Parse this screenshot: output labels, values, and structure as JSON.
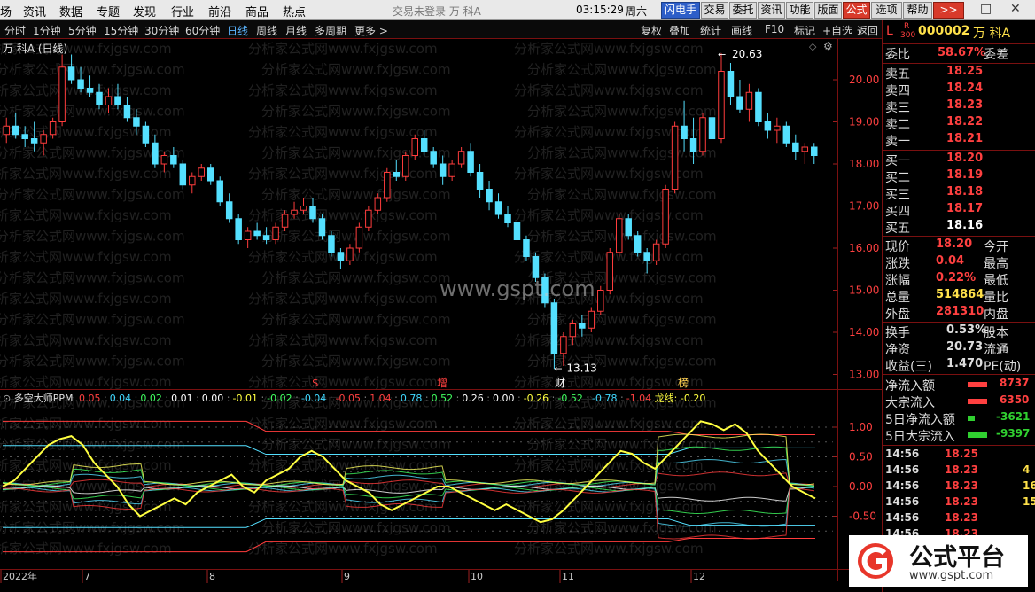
{
  "menu": {
    "items": [
      "场",
      "资讯",
      "数据",
      "专题",
      "发现",
      "行业",
      "前沿",
      "商品",
      "热点"
    ],
    "center_text": "交易未登录   万 科A",
    "time": "03:15:29",
    "weekday": "周六",
    "buttons": [
      "闪电手",
      "交易",
      "委托",
      "资讯",
      "功能",
      "版面",
      "公式",
      "选项",
      "帮助",
      ">>"
    ],
    "window_controls": [
      "□",
      "✕"
    ]
  },
  "toolbar": {
    "periods": [
      "分时",
      "1分钟",
      "5分钟",
      "15分钟",
      "30分钟",
      "60分钟",
      "日线",
      "周线",
      "月线",
      "多周期",
      "更多 >"
    ],
    "active_period": "日线",
    "right_buttons": [
      "复权",
      "叠加",
      "统计",
      "画线",
      "F10",
      "标记",
      "+自选",
      "返回"
    ]
  },
  "chart_title": "万 科A (日线)",
  "watermarks": {
    "faint": "分析家公式网www.fxjgsw.com",
    "center": "www.gspt.com"
  },
  "price_axis": [
    "20.00",
    "19.00",
    "18.00",
    "17.00",
    "16.00",
    "15.00",
    "14.00",
    "13.00"
  ],
  "max_label": "20.63",
  "min_label": "13.13",
  "event_markers": [
    {
      "label": "$",
      "color": "#ff4040"
    },
    {
      "label": "增",
      "color": "#ff4040"
    },
    {
      "label": "财",
      "color": "#ffffff"
    },
    {
      "label": "榜",
      "color": "#ffd050"
    }
  ],
  "indicator": {
    "name": "多空大师PPM",
    "values": [
      {
        "v": "0.05",
        "c": "#ff4040"
      },
      {
        "v": "0.04",
        "c": "#40d8ff"
      },
      {
        "v": "0.02",
        "c": "#40ff60"
      },
      {
        "v": "0.01",
        "c": "#ffffff"
      },
      {
        "v": "0.00",
        "c": "#ffffff"
      },
      {
        "v": "-0.01",
        "c": "#ffff40"
      },
      {
        "v": "-0.02",
        "c": "#40ff60"
      },
      {
        "v": "-0.04",
        "c": "#40d8ff"
      },
      {
        "v": "-0.05",
        "c": "#ff4040"
      },
      {
        "v": "1.04",
        "c": "#ff4040"
      },
      {
        "v": "0.78",
        "c": "#40d8ff"
      },
      {
        "v": "0.52",
        "c": "#40ff60"
      },
      {
        "v": "0.26",
        "c": "#ffffff"
      },
      {
        "v": "0.00",
        "c": "#ffffff"
      },
      {
        "v": "-0.26",
        "c": "#ffff40"
      },
      {
        "v": "-0.52",
        "c": "#40ff60"
      },
      {
        "v": "-0.78",
        "c": "#40d8ff"
      },
      {
        "v": "-1.04",
        "c": "#ff4040"
      }
    ],
    "dragon_label": "龙线: -0.20",
    "axis": [
      "1.00",
      "0.50",
      "0.00",
      "-0.50"
    ]
  },
  "x_axis": [
    "2022年",
    "7",
    "8",
    "9",
    "10",
    "11",
    "12"
  ],
  "quote": {
    "code_prefix": "L",
    "r_mark": "R",
    "r_num": "300",
    "code": "000002",
    "name": "万 科A",
    "weibi_label": "委比",
    "weibi": "58.67%",
    "weicha_label": "委差",
    "sell": [
      {
        "label": "卖五",
        "price": "18.25"
      },
      {
        "label": "卖四",
        "price": "18.24"
      },
      {
        "label": "卖三",
        "price": "18.23"
      },
      {
        "label": "卖二",
        "price": "18.22"
      },
      {
        "label": "卖一",
        "price": "18.21"
      }
    ],
    "buy": [
      {
        "label": "买一",
        "price": "18.20"
      },
      {
        "label": "买二",
        "price": "18.19"
      },
      {
        "label": "买三",
        "price": "18.18"
      },
      {
        "label": "买四",
        "price": "18.17"
      },
      {
        "label": "买五",
        "price": "18.16"
      }
    ],
    "stats1": [
      {
        "label": "现价",
        "value": "18.20",
        "right": "今开",
        "color": "#ff4040"
      },
      {
        "label": "涨跌",
        "value": "0.04",
        "right": "最高",
        "color": "#ff4040"
      },
      {
        "label": "涨幅",
        "value": "0.22%",
        "right": "最低",
        "color": "#ff4040"
      },
      {
        "label": "总量",
        "value": "514864",
        "right": "量比",
        "color": "#ffe14a"
      },
      {
        "label": "外盘",
        "value": "281310",
        "right": "内盘",
        "color": "#ff4040"
      }
    ],
    "stats2": [
      {
        "label": "换手",
        "value": "0.53%",
        "right": "股本"
      },
      {
        "label": "净资",
        "value": "20.73",
        "right": "流通"
      },
      {
        "label": "收益(三)",
        "value": "1.470",
        "right": "PE(动)"
      }
    ],
    "flows": [
      {
        "label": "净流入额",
        "value": "8737",
        "bar": "#ff4040",
        "color": "#ff4040"
      },
      {
        "label": "大宗流入",
        "value": "6350",
        "bar": "#ff4040",
        "color": "#ff4040"
      },
      {
        "label": "5日净流入额",
        "value": "-3621",
        "bar": "#30d030",
        "color": "#30d030"
      },
      {
        "label": "5日大宗流入",
        "value": "-9397",
        "bar": "#30d030",
        "color": "#30d030"
      }
    ],
    "ticks": [
      {
        "time": "14:56",
        "price": "18.25",
        "vol": ""
      },
      {
        "time": "14:56",
        "price": "18.23",
        "vol": "4"
      },
      {
        "time": "14:56",
        "price": "18.23",
        "vol": "16"
      },
      {
        "time": "14:56",
        "price": "18.23",
        "vol": "15"
      },
      {
        "time": "14:56",
        "price": "18.23",
        "vol": ""
      },
      {
        "time": "14:56",
        "price": "18.23",
        "vol": ""
      }
    ]
  },
  "logo": {
    "title": "公式平台",
    "url": "www.gspt.com"
  },
  "chart_data": {
    "type": "candlestick",
    "ylim": [
      12.8,
      20.8
    ],
    "candles": [
      [
        18.7,
        19.1,
        18.5,
        18.9
      ],
      [
        18.9,
        19.2,
        18.6,
        18.7
      ],
      [
        18.7,
        18.9,
        18.4,
        18.6
      ],
      [
        18.6,
        19.0,
        18.3,
        18.5
      ],
      [
        18.5,
        18.8,
        18.2,
        18.7
      ],
      [
        18.7,
        19.1,
        18.6,
        19.0
      ],
      [
        19.0,
        20.6,
        18.9,
        20.3
      ],
      [
        20.3,
        20.6,
        19.9,
        20.0
      ],
      [
        20.0,
        20.3,
        19.7,
        19.8
      ],
      [
        19.8,
        20.1,
        19.6,
        19.7
      ],
      [
        19.7,
        19.9,
        19.3,
        19.4
      ],
      [
        19.4,
        19.8,
        19.2,
        19.6
      ],
      [
        19.6,
        19.9,
        19.3,
        19.4
      ],
      [
        19.4,
        19.6,
        19.0,
        19.1
      ],
      [
        19.1,
        19.3,
        18.7,
        18.9
      ],
      [
        18.9,
        19.0,
        18.4,
        18.5
      ],
      [
        18.5,
        18.7,
        17.9,
        18.0
      ],
      [
        18.0,
        18.3,
        17.8,
        18.2
      ],
      [
        18.2,
        18.4,
        17.9,
        18.0
      ],
      [
        18.0,
        18.1,
        17.4,
        17.5
      ],
      [
        17.5,
        17.8,
        17.3,
        17.7
      ],
      [
        17.7,
        18.0,
        17.6,
        17.9
      ],
      [
        17.9,
        18.0,
        17.5,
        17.6
      ],
      [
        17.6,
        17.7,
        17.0,
        17.1
      ],
      [
        17.1,
        17.3,
        16.6,
        16.7
      ],
      [
        16.7,
        16.8,
        16.1,
        16.2
      ],
      [
        16.2,
        16.5,
        16.0,
        16.4
      ],
      [
        16.4,
        16.6,
        16.2,
        16.3
      ],
      [
        16.3,
        16.5,
        16.1,
        16.2
      ],
      [
        16.2,
        16.6,
        16.1,
        16.5
      ],
      [
        16.5,
        16.9,
        16.4,
        16.8
      ],
      [
        16.8,
        17.1,
        16.7,
        16.9
      ],
      [
        16.9,
        17.2,
        16.8,
        17.0
      ],
      [
        17.0,
        17.2,
        16.6,
        16.7
      ],
      [
        16.7,
        16.8,
        16.2,
        16.3
      ],
      [
        16.3,
        16.4,
        15.8,
        15.9
      ],
      [
        15.9,
        16.0,
        15.5,
        15.7
      ],
      [
        15.7,
        16.1,
        15.6,
        16.0
      ],
      [
        16.0,
        16.6,
        15.9,
        16.5
      ],
      [
        16.5,
        17.0,
        16.4,
        16.9
      ],
      [
        16.9,
        17.3,
        16.8,
        17.2
      ],
      [
        17.2,
        17.9,
        17.1,
        17.8
      ],
      [
        17.8,
        18.1,
        17.6,
        17.7
      ],
      [
        17.7,
        18.3,
        17.6,
        18.2
      ],
      [
        18.2,
        18.7,
        18.1,
        18.6
      ],
      [
        18.6,
        18.8,
        18.2,
        18.3
      ],
      [
        18.3,
        18.4,
        17.9,
        18.0
      ],
      [
        18.0,
        18.2,
        17.5,
        17.7
      ],
      [
        17.7,
        18.1,
        17.6,
        18.0
      ],
      [
        18.0,
        18.4,
        17.9,
        18.3
      ],
      [
        18.3,
        18.5,
        17.7,
        17.8
      ],
      [
        17.8,
        18.0,
        17.2,
        17.4
      ],
      [
        17.4,
        17.6,
        16.9,
        17.1
      ],
      [
        17.1,
        17.3,
        16.7,
        16.8
      ],
      [
        16.8,
        17.0,
        16.5,
        16.6
      ],
      [
        16.6,
        16.7,
        16.1,
        16.2
      ],
      [
        16.2,
        16.3,
        15.7,
        15.8
      ],
      [
        15.8,
        15.9,
        15.2,
        15.3
      ],
      [
        15.3,
        15.4,
        14.6,
        14.7
      ],
      [
        14.7,
        14.8,
        13.13,
        13.5
      ],
      [
        13.5,
        14.0,
        13.2,
        13.9
      ],
      [
        13.9,
        14.3,
        13.7,
        14.2
      ],
      [
        14.2,
        14.4,
        13.9,
        14.1
      ],
      [
        14.1,
        14.6,
        14.0,
        14.5
      ],
      [
        14.5,
        15.1,
        14.4,
        15.0
      ],
      [
        15.0,
        16.0,
        14.9,
        15.9
      ],
      [
        15.9,
        16.8,
        15.8,
        16.7
      ],
      [
        16.7,
        16.8,
        16.2,
        16.3
      ],
      [
        16.3,
        16.4,
        15.8,
        15.9
      ],
      [
        15.9,
        16.0,
        15.4,
        15.7
      ],
      [
        15.7,
        16.2,
        15.6,
        16.1
      ],
      [
        16.1,
        17.5,
        16.0,
        17.4
      ],
      [
        17.4,
        19.0,
        17.3,
        18.9
      ],
      [
        18.9,
        19.5,
        18.3,
        18.6
      ],
      [
        18.6,
        19.1,
        18.0,
        18.3
      ],
      [
        18.3,
        19.2,
        18.2,
        19.1
      ],
      [
        19.1,
        19.3,
        18.4,
        18.6
      ],
      [
        18.6,
        20.63,
        18.5,
        20.2
      ],
      [
        20.2,
        20.4,
        19.4,
        19.6
      ],
      [
        19.6,
        20.0,
        19.2,
        19.3
      ],
      [
        19.3,
        19.9,
        19.0,
        19.7
      ],
      [
        19.7,
        19.8,
        18.9,
        19.0
      ],
      [
        19.0,
        19.2,
        18.6,
        18.8
      ],
      [
        18.8,
        19.1,
        18.5,
        18.9
      ],
      [
        18.9,
        19.0,
        18.4,
        18.5
      ],
      [
        18.5,
        18.7,
        18.1,
        18.3
      ],
      [
        18.3,
        18.5,
        18.0,
        18.4
      ],
      [
        18.4,
        18.5,
        18.0,
        18.2
      ]
    ],
    "indicator_series": {
      "name": "龙线",
      "values": [
        0.0,
        0.1,
        0.3,
        0.5,
        0.7,
        0.8,
        0.85,
        0.7,
        0.4,
        0.2,
        0.0,
        -0.3,
        -0.5,
        -0.4,
        -0.3,
        -0.2,
        -0.3,
        -0.1,
        0.0,
        0.1,
        0.2,
        0.0,
        -0.1,
        0.1,
        0.2,
        0.3,
        0.5,
        0.6,
        0.5,
        0.3,
        0.1,
        0.0,
        -0.1,
        -0.3,
        -0.4,
        -0.3,
        -0.2,
        -0.1,
        0.0,
        0.0,
        -0.1,
        -0.2,
        -0.3,
        -0.4,
        -0.3,
        -0.4,
        -0.5,
        -0.6,
        -0.55,
        -0.4,
        -0.2,
        0.0,
        0.2,
        0.4,
        0.6,
        0.55,
        0.4,
        0.3,
        0.5,
        0.7,
        0.9,
        1.1,
        1.05,
        0.95,
        1.05,
        0.9,
        0.6,
        0.4,
        0.2,
        0.0,
        -0.1,
        -0.2
      ]
    }
  }
}
